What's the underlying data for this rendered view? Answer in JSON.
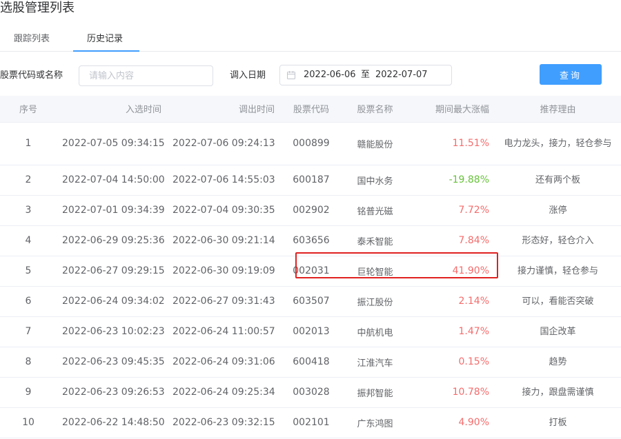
{
  "page": {
    "title": "选股管理列表"
  },
  "tabs": [
    {
      "label": "跟踪列表",
      "active": false
    },
    {
      "label": "历史记录",
      "active": true
    }
  ],
  "filters": {
    "code_label": "股票代码或名称",
    "code_value": "",
    "code_placeholder": "请输入内容",
    "date_label": "调入日期",
    "date_start": "2022-06-06",
    "date_sep": "至",
    "date_end": "2022-07-07",
    "query_label": "查询"
  },
  "table": {
    "headers": [
      "序号",
      "入选时间",
      "调出时间",
      "股票代码",
      "股票名称",
      "期间最大涨幅",
      "推荐理由"
    ],
    "rows": [
      {
        "no": "1",
        "in_time": "2022-07-05 09:34:15",
        "out_time": "2022-07-06 09:24:13",
        "code": "000899",
        "name": "赣能股份",
        "gain": "11.51%",
        "direction": "up",
        "reason": "电力龙头，接力，轻仓参与"
      },
      {
        "no": "2",
        "in_time": "2022-07-04 14:50:00",
        "out_time": "2022-07-06 14:55:03",
        "code": "600187",
        "name": "国中水务",
        "gain": "-19.88%",
        "direction": "down",
        "reason": "还有两个板"
      },
      {
        "no": "3",
        "in_time": "2022-07-01 09:34:39",
        "out_time": "2022-07-04 09:30:35",
        "code": "002902",
        "name": "铭普光磁",
        "gain": "7.72%",
        "direction": "up",
        "reason": "涨停"
      },
      {
        "no": "4",
        "in_time": "2022-06-29 09:25:36",
        "out_time": "2022-06-30 09:21:14",
        "code": "603656",
        "name": "泰禾智能",
        "gain": "7.84%",
        "direction": "up",
        "reason": "形态好，轻仓介入"
      },
      {
        "no": "5",
        "in_time": "2022-06-27 09:29:15",
        "out_time": "2022-06-30 09:19:09",
        "code": "002031",
        "name": "巨轮智能",
        "gain": "41.90%",
        "direction": "up",
        "reason": "接力谨慎，轻仓参与"
      },
      {
        "no": "6",
        "in_time": "2022-06-24 09:34:02",
        "out_time": "2022-06-27 09:31:43",
        "code": "603507",
        "name": "振江股份",
        "gain": "2.14%",
        "direction": "up",
        "reason": "可以，看能否突破"
      },
      {
        "no": "7",
        "in_time": "2022-06-23 10:02:23",
        "out_time": "2022-06-24 11:00:57",
        "code": "002013",
        "name": "中航机电",
        "gain": "1.47%",
        "direction": "up",
        "reason": "国企改革"
      },
      {
        "no": "8",
        "in_time": "2022-06-23 09:45:35",
        "out_time": "2022-06-24 09:31:06",
        "code": "600418",
        "name": "江淮汽车",
        "gain": "0.15%",
        "direction": "up",
        "reason": "趋势"
      },
      {
        "no": "9",
        "in_time": "2022-06-23 09:26:53",
        "out_time": "2022-06-24 09:25:34",
        "code": "003028",
        "name": "振邦智能",
        "gain": "10.78%",
        "direction": "up",
        "reason": "接力，跟盘需谨慎"
      },
      {
        "no": "10",
        "in_time": "2022-06-22 14:48:50",
        "out_time": "2022-06-23 09:32:15",
        "code": "002101",
        "name": "广东鸿图",
        "gain": "4.90%",
        "direction": "up",
        "reason": "打板"
      }
    ]
  },
  "colors": {
    "accent": "#409eff",
    "gain_up": "#f56c6c",
    "gain_down": "#67c23a",
    "highlight_border": "#e02020"
  },
  "icons": {
    "date": "calendar-icon"
  }
}
